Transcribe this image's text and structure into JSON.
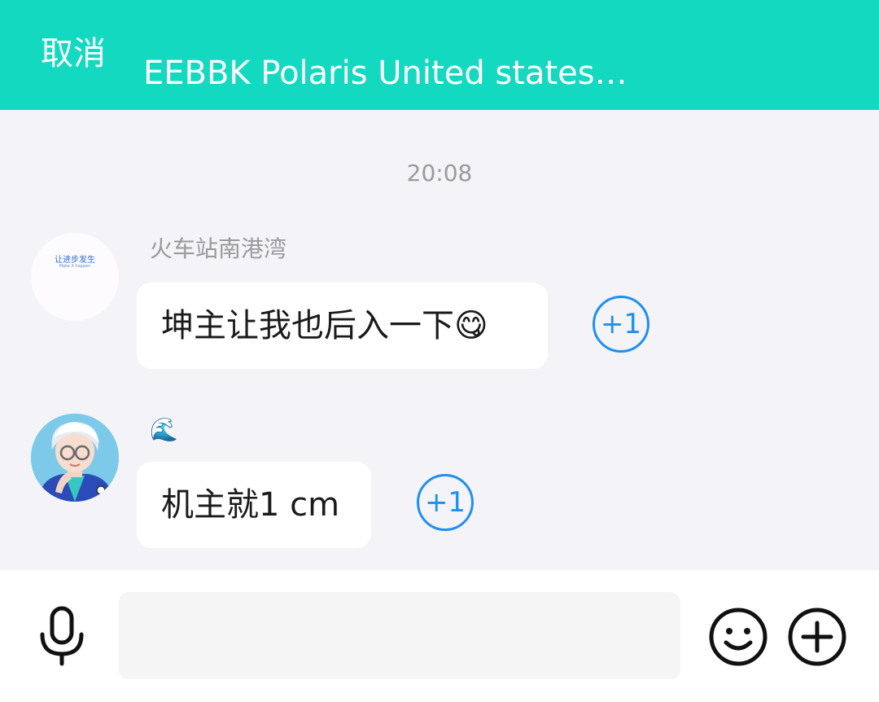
{
  "header": {
    "cancel_label": "取消",
    "title": "EEBBK Polaris United states…"
  },
  "chat": {
    "timestamp": "20:08",
    "messages": [
      {
        "sender": "火车站南港湾",
        "avatar": {
          "logo_text": "让进步发生",
          "logo_subtext": "Make it happen"
        },
        "text": "坤主让我也后入一下😋",
        "plus_label": "+1"
      },
      {
        "sender": "🌊",
        "avatar": {
          "icon": "cartoon-avatar-icon"
        },
        "text": "机主就1 cm",
        "plus_label": "+1"
      }
    ]
  },
  "input_bar": {
    "placeholder": "",
    "value": "",
    "icons": [
      "microphone-icon",
      "smiley-icon",
      "plus-circle-icon"
    ]
  },
  "colors": {
    "header_bg": "#13d9c0",
    "plus_one": "#1e8ff2",
    "chat_bg": "#f4f4f8"
  }
}
